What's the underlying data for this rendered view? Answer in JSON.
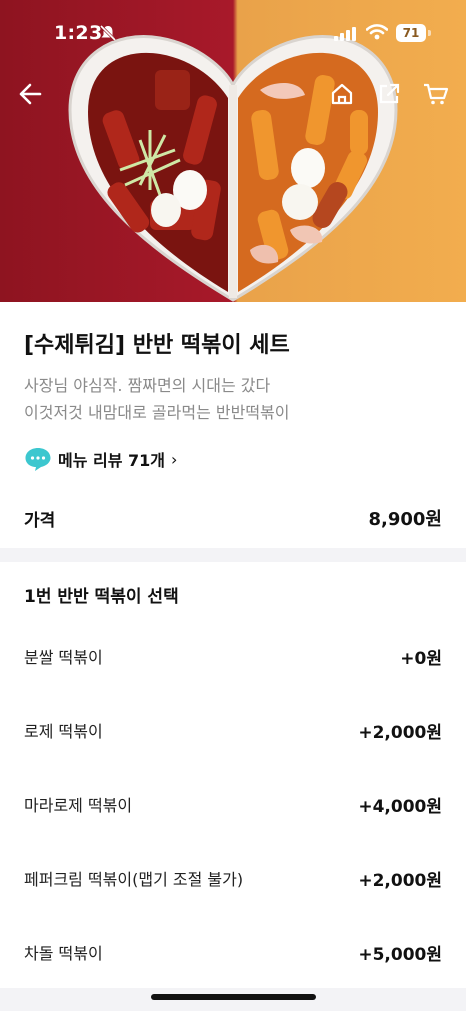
{
  "status_bar": {
    "time": "1:23",
    "battery": "71"
  },
  "product": {
    "title": "[수제튀김] 반반 떡볶이 세트",
    "description_lines": [
      "사장님 야심작. 짬짜면의 시대는 갔다",
      "이것저것 내맘대로 골라먹는 반반떡볶이"
    ],
    "review_label": "메뉴 리뷰 71개",
    "review_chevron": "›",
    "price_label": "가격",
    "price_value": "8,900원"
  },
  "option_group": {
    "title": "1번 반반 떡볶이 선택",
    "options": [
      {
        "name": "분쌀 떡볶이",
        "price": "+0원"
      },
      {
        "name": "로제 떡볶이",
        "price": "+2,000원"
      },
      {
        "name": "마라로제 떡볶이",
        "price": "+4,000원"
      },
      {
        "name": "페퍼크림 떡볶이(맵기 조절 불가)",
        "price": "+2,000원"
      },
      {
        "name": "차돌 떡볶이",
        "price": "+5,000원"
      }
    ]
  },
  "icons": [
    "back-arrow-icon",
    "home-icon",
    "share-icon",
    "cart-icon",
    "speech-bubble-icon",
    "mute-bell-icon",
    "signal-icon",
    "wifi-icon"
  ],
  "colors": {
    "hero_left": "#a8192a",
    "hero_right": "#f2ad4e",
    "review_icon": "#3cc7cf",
    "divider": "#f3f3f6"
  }
}
